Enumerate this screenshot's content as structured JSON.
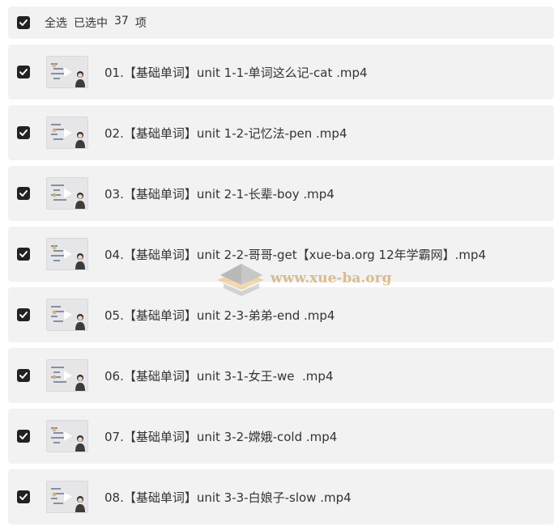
{
  "header": {
    "select_all_label": "全选",
    "selected_prefix": "已选中",
    "selected_count": "37",
    "selected_suffix": "项",
    "checked": true
  },
  "files": [
    {
      "name": "01.【基础单词】unit 1-1-单词这么记-cat .mp4",
      "checked": true
    },
    {
      "name": "02.【基础单词】unit 1-2-记忆法-pen .mp4",
      "checked": true
    },
    {
      "name": "03.【基础单词】unit 2-1-长辈-boy .mp4",
      "checked": true
    },
    {
      "name": "04.【基础单词】unit 2-2-哥哥-get【xue-ba.org 12年学霸网】.mp4",
      "checked": true
    },
    {
      "name": "05.【基础单词】unit 2-3-弟弟-end .mp4",
      "checked": true
    },
    {
      "name": "06.【基础单词】unit 3-1-女王-we  .mp4",
      "checked": true
    },
    {
      "name": "07.【基础单词】unit 3-2-嫦娥-cold .mp4",
      "checked": true
    },
    {
      "name": "08.【基础单词】unit 3-3-白娘子-slow .mp4",
      "checked": true
    }
  ],
  "watermark": {
    "text": "www.xue-ba.org",
    "color": "#c98e3a"
  },
  "icons": {
    "checkbox": "checkmark-icon",
    "thumbnail_overlay": "play-icon"
  },
  "colors": {
    "row_background": "#f2f2f3",
    "checkbox_fill": "#222222",
    "text": "#333333"
  }
}
